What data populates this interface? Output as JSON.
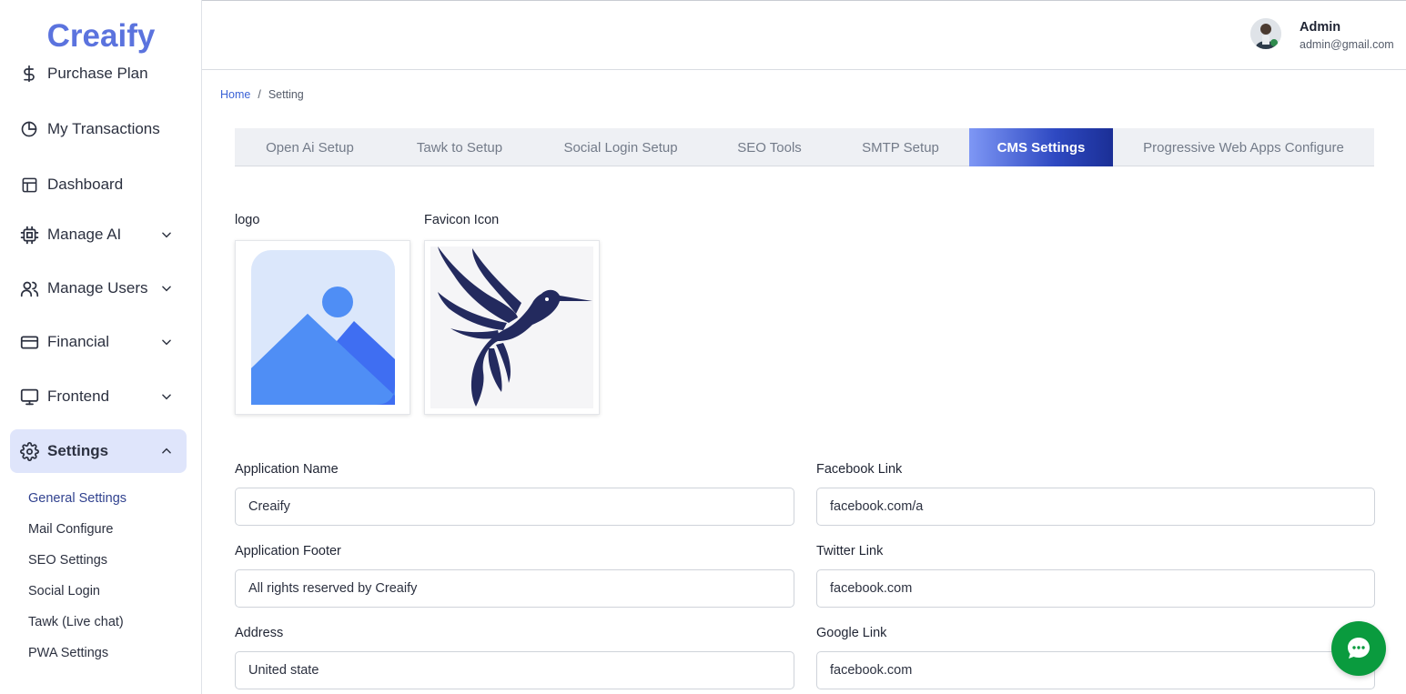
{
  "brand": {
    "name": "Creaify",
    "color": "#5b73de"
  },
  "sidebar": {
    "items": [
      {
        "label": "Purchase Plan",
        "icon": "dollar-icon"
      },
      {
        "label": "My Transactions",
        "icon": "pie-chart-icon"
      },
      {
        "label": "Dashboard",
        "icon": "layout-icon"
      },
      {
        "label": "Manage AI",
        "icon": "cpu-icon",
        "expandable": true
      },
      {
        "label": "Manage Users",
        "icon": "users-icon",
        "expandable": true
      },
      {
        "label": "Financial",
        "icon": "credit-card-icon",
        "expandable": true
      },
      {
        "label": "Frontend",
        "icon": "monitor-icon",
        "expandable": true
      },
      {
        "label": "Settings",
        "icon": "gear-icon",
        "expandable": true,
        "expanded": true,
        "active": true
      }
    ],
    "settings_sub": [
      {
        "label": "General Settings",
        "active": true
      },
      {
        "label": "Mail Configure"
      },
      {
        "label": "SEO Settings"
      },
      {
        "label": "Social Login"
      },
      {
        "label": "Tawk (Live chat)"
      },
      {
        "label": "PWA Settings"
      }
    ]
  },
  "header": {
    "user_name": "Admin",
    "user_email": "admin@gmail.com"
  },
  "breadcrumb": {
    "home": "Home",
    "separator": "/",
    "current": "Setting"
  },
  "tabs": [
    {
      "label": "Open Ai Setup"
    },
    {
      "label": "Tawk to Setup"
    },
    {
      "label": "Social Login Setup"
    },
    {
      "label": "SEO Tools"
    },
    {
      "label": "SMTP Setup"
    },
    {
      "label": "CMS Settings",
      "active": true
    },
    {
      "label": "Progressive Web Apps Configure"
    }
  ],
  "images": {
    "logo_label": "logo",
    "favicon_label": "Favicon Icon"
  },
  "form": {
    "application_name": {
      "label": "Application Name",
      "value": "Creaify"
    },
    "application_footer": {
      "label": "Application Footer",
      "value": "All rights reserved by Creaify"
    },
    "address": {
      "label": "Address",
      "value": "United state"
    },
    "facebook_link": {
      "label": "Facebook Link",
      "value": "facebook.com/a"
    },
    "twitter_link": {
      "label": "Twitter Link",
      "value": "facebook.com"
    },
    "google_link": {
      "label": "Google Link",
      "value": "facebook.com"
    }
  },
  "colors": {
    "accent": "#2e49c2",
    "chat": "#0a9b3e",
    "link": "#3b62d6"
  }
}
